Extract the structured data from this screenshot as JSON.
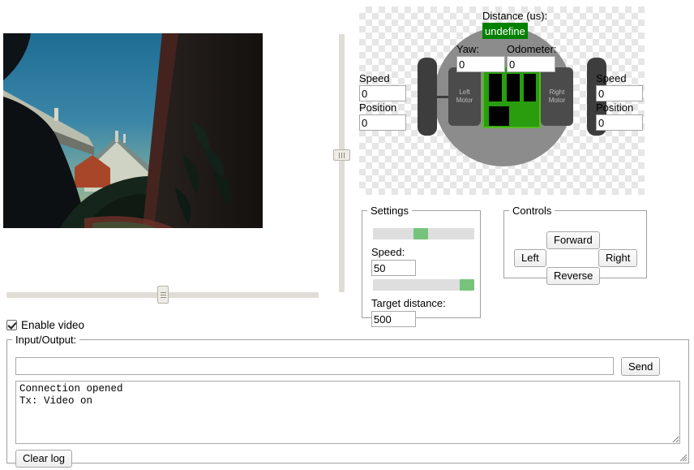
{
  "video": {
    "name": "camera-stream",
    "description": "Dusk view through a window: blue sky, rooftops of houses, plant leaves and a dark window frame in silhouette"
  },
  "splitters": {
    "vertical_handle_icon": "vertical-grip-icon",
    "horizontal_handle_icon": "horizontal-grip-icon"
  },
  "robot": {
    "distance_label": "Distance (us):",
    "distance_value": "undefined",
    "yaw_label": "Yaw:",
    "yaw_value": "0",
    "odometer_label": "Odometer:",
    "odometer_value": "0",
    "left": {
      "speed_label": "Speed",
      "speed_value": "0",
      "position_label": "Position",
      "position_value": "0",
      "motor_label_line1": "Left",
      "motor_label_line2": "Motor"
    },
    "right": {
      "speed_label": "Speed",
      "speed_value": "0",
      "position_label": "Position",
      "position_value": "0",
      "motor_label_line1": "Right",
      "motor_label_line2": "Motor"
    },
    "colors": {
      "body": "#8c8c8c",
      "wheel": "#3d3d3d",
      "motor": "#4b4b4b",
      "pcb": "#2a9d0f",
      "pcb_border": "#53bb22",
      "chip": "#000000",
      "distance_highlight": "#008000"
    }
  },
  "settings": {
    "legend": "Settings",
    "speed_label": "Speed:",
    "speed_value": "50",
    "speed_slider_percent": 50,
    "target_distance_label": "Target distance:",
    "target_distance_value": "500",
    "target_distance_slider_percent": 100,
    "slider_track_color": "#dedede",
    "slider_thumb_color": "#76c47c"
  },
  "controls": {
    "legend": "Controls",
    "forward_label": "Forward",
    "left_label": "Left",
    "right_label": "Right",
    "reverse_label": "Reverse"
  },
  "enable_video": {
    "label": "Enable video",
    "checked": true
  },
  "io": {
    "legend": "Input/Output:",
    "command_value": "",
    "command_placeholder": "",
    "send_label": "Send",
    "log_text": "Connection opened\nTx: Video on",
    "clear_log_label": "Clear log",
    "resize_handle_icon": "resize-grip-icon"
  }
}
